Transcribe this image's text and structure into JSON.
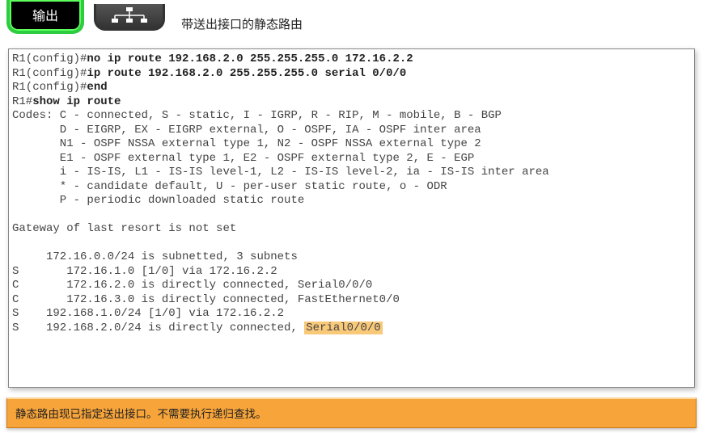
{
  "header": {
    "output_button": "输出",
    "title": "带送出接口的静态路由"
  },
  "terminal": {
    "prompt1": "R1(config)#",
    "cmd1": "no ip route 192.168.2.0 255.255.255.0 172.16.2.2",
    "prompt2": "R1(config)#",
    "cmd2": "ip route 192.168.2.0 255.255.255.0 serial 0/0/0",
    "prompt3": "R1(config)#",
    "cmd3": "end",
    "prompt4": "R1#",
    "cmd4": "show ip route",
    "codes_line": "Codes: C - connected, S - static, I - IGRP, R - RIP, M - mobile, B - BGP",
    "codes_d": "       D - EIGRP, EX - EIGRP external, O - OSPF, IA - OSPF inter area",
    "codes_n1": "       N1 - OSPF NSSA external type 1, N2 - OSPF NSSA external type 2",
    "codes_e1": "       E1 - OSPF external type 1, E2 - OSPF external type 2, E - EGP",
    "codes_i": "       i - IS-IS, L1 - IS-IS level-1, L2 - IS-IS level-2, ia - IS-IS inter area",
    "codes_star": "       * - candidate default, U - per-user static route, o - ODR",
    "codes_p": "       P - periodic downloaded static route",
    "gateway": "Gateway of last resort is not set",
    "subnet_hdr": "     172.16.0.0/24 is subnetted, 3 subnets",
    "route_s1": "S       172.16.1.0 [1/0] via 172.16.2.2",
    "route_c1": "C       172.16.2.0 is directly connected, Serial0/0/0",
    "route_c2": "C       172.16.3.0 is directly connected, FastEthernet0/0",
    "route_s2": "S    192.168.1.0/24 [1/0] via 172.16.2.2",
    "route_s3a": "S    192.168.2.0/24 is directly connected, ",
    "route_s3_hl": "Serial0/0/0"
  },
  "footer": {
    "text": "静态路由现已指定送出接口。不需要执行递归查找。"
  }
}
